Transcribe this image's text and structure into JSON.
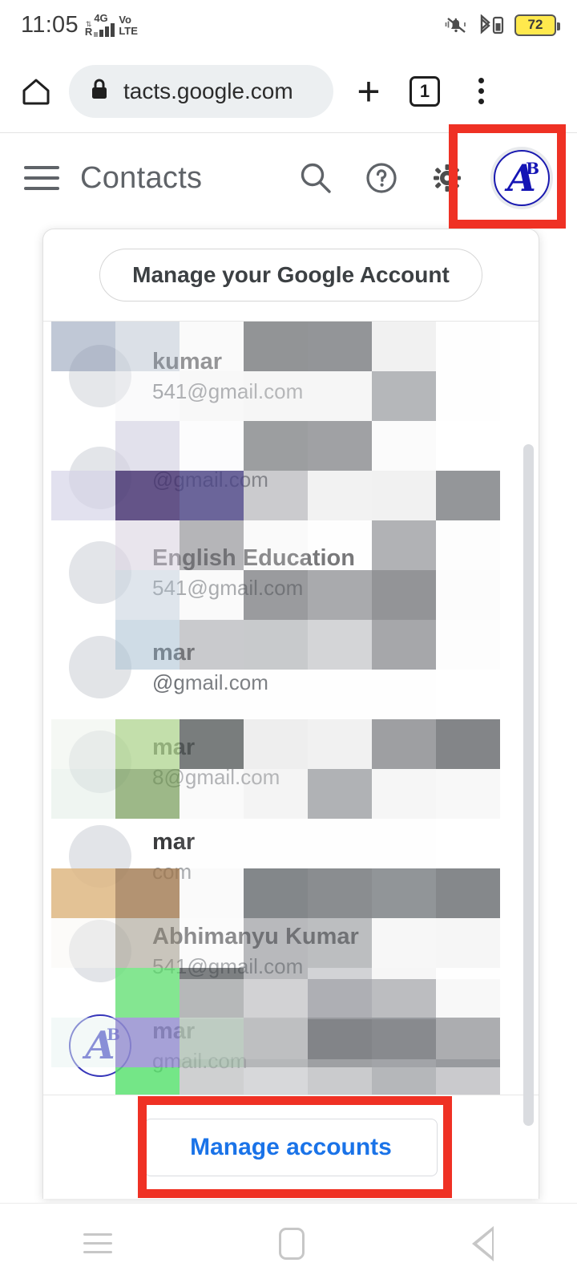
{
  "statusbar": {
    "time": "11:05",
    "roaming_label": "R",
    "network_label": "4G",
    "volte_line1": "Vo",
    "volte_line2": "LTE",
    "mute_icon": "bell-mute-icon",
    "bluetooth_icon": "bluetooth-battery-icon",
    "battery_percent": "72",
    "battery_color": "#ffe94d"
  },
  "browser": {
    "home_icon": "home-icon",
    "lock_icon": "lock-icon",
    "url": "tacts.google.com",
    "new_tab_label": "+",
    "tab_count": "1",
    "menu_icon": "kebab-menu-icon"
  },
  "appbar": {
    "menu_icon": "hamburger-menu-icon",
    "title": "Contacts",
    "search_icon": "search-icon",
    "help_icon": "help-icon",
    "settings_icon": "gear-icon",
    "avatar_letter": "A",
    "avatar_superscript": "B"
  },
  "panel": {
    "manage_google_account_label": "Manage your Google Account",
    "manage_accounts_label": "Manage accounts",
    "accounts": [
      {
        "name": "kumar",
        "email": "541@gmail.com",
        "avatar": "photo",
        "redacted": true
      },
      {
        "name": "",
        "email": "@gmail.com",
        "avatar": "photo",
        "redacted": true
      },
      {
        "name": "English Education",
        "email": "541@gmail.com",
        "avatar": "photo",
        "redacted": true
      },
      {
        "name": "mar",
        "email": "@gmail.com",
        "avatar": "photo",
        "redacted": true
      },
      {
        "name": "mar",
        "email": "8@gmail.com",
        "avatar": "photo",
        "redacted": true
      },
      {
        "name": "mar",
        "email": "com",
        "avatar": "photo",
        "redacted": true
      },
      {
        "name": "Abhimanyu Kumar",
        "email": "541@gmail.com",
        "avatar": "photo",
        "redacted": true
      },
      {
        "name": "mar",
        "email": "gmail.com",
        "avatar": "ab-logo",
        "redacted": true
      }
    ]
  },
  "highlights": {
    "color": "#ef3124",
    "avatar_box_name": "avatar-highlight",
    "manage_box_name": "manage-accounts-highlight"
  },
  "navbar": {
    "recents_icon": "recents-icon",
    "home_icon": "home-square-icon",
    "back_icon": "back-triangle-icon"
  }
}
